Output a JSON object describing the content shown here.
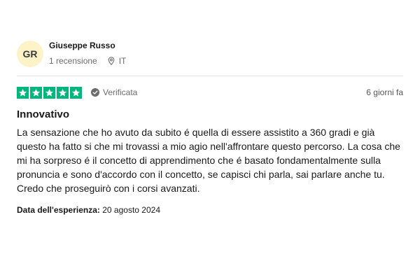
{
  "reviewer": {
    "initials": "GR",
    "name": "Giuseppe Russo",
    "review_count": "1 recensione",
    "country": "IT",
    "location_icon": "location-pin-icon"
  },
  "review": {
    "rating": 5,
    "max_rating": 5,
    "verified_label": "Verificata",
    "posted_ago": "6 giorni fa",
    "title": "Innovativo",
    "paragraphs": [
      "La sensazione che ho avuto da subito é quella di essere assistito a 360 gradi e già questo ha fatto si che mi trovassi a mio agio nell'affrontare questo percorso. La cosa che mi ha sorpreso é il concetto di apprendimento che é basato fondamentalmente sulla pronuncia e sono d'accordo con il concetto, se capisci chi parla, sai parlare anche tu.",
      "Credo che proseguirò con i corsi avanzati."
    ],
    "experience_label": "Data dell'esperienza:",
    "experience_date": "20 agosto 2024"
  },
  "colors": {
    "star_green": "#00b67a",
    "avatar_bg": "#fdf2c8",
    "muted_text": "#6b6b6b"
  }
}
